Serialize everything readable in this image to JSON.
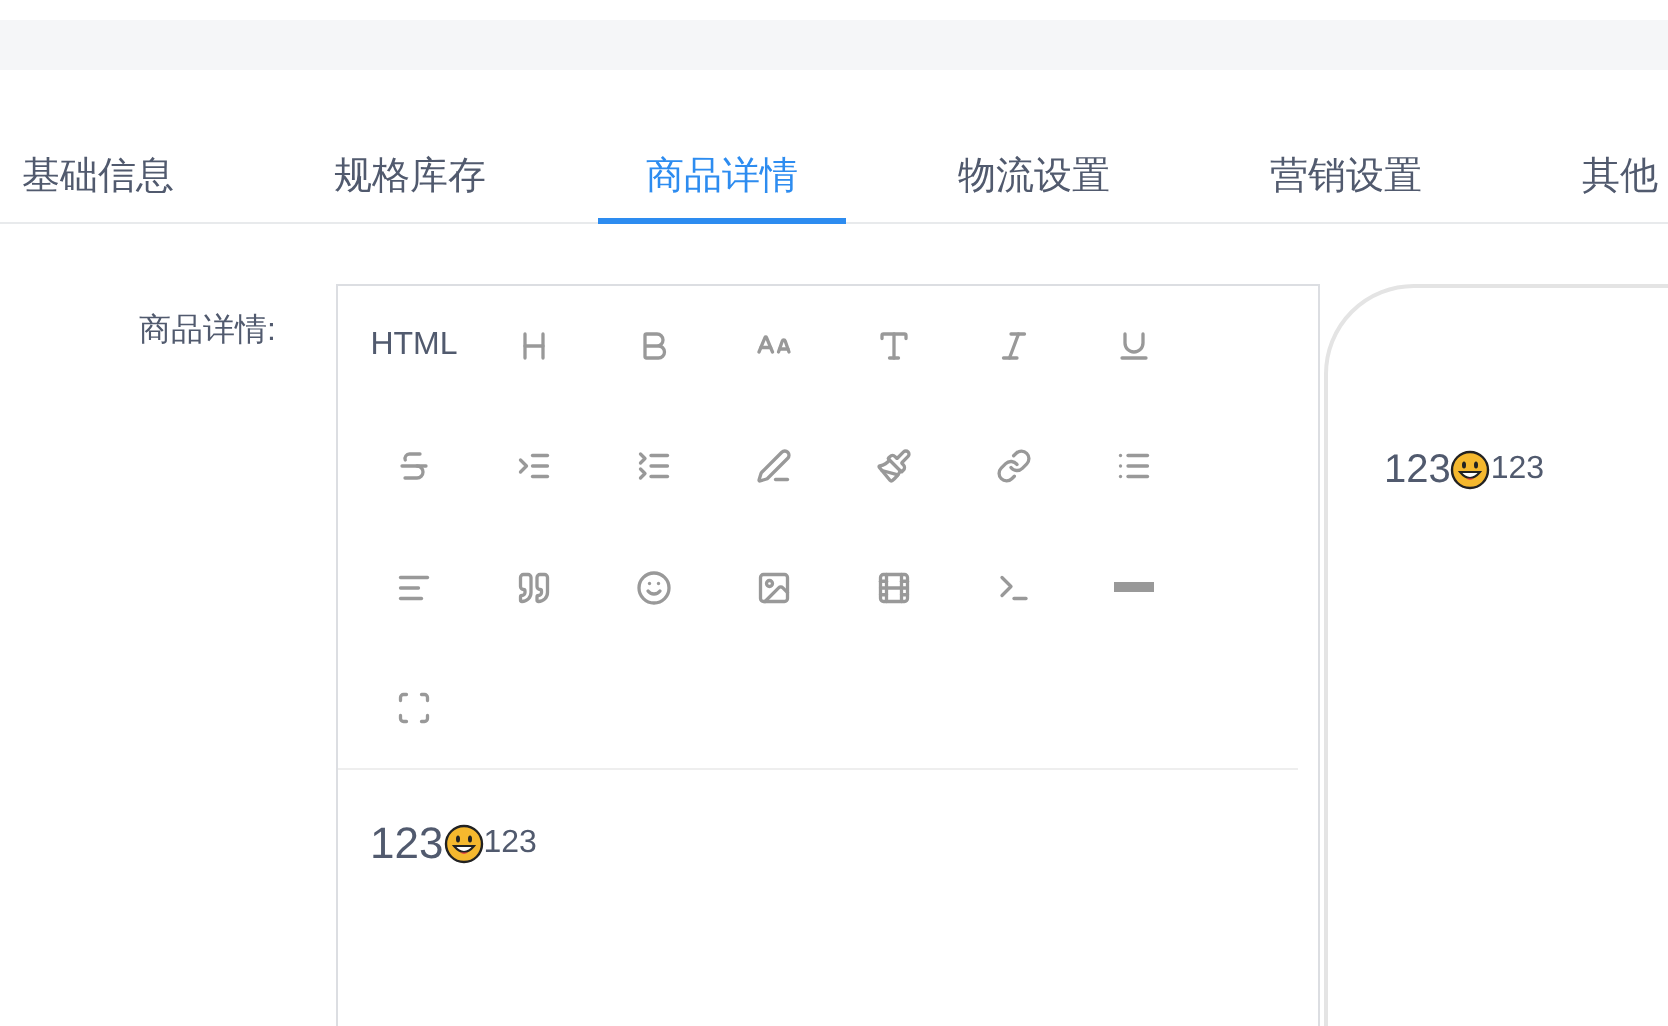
{
  "tabs": [
    {
      "label": "基础信息",
      "selected": false
    },
    {
      "label": "规格库存",
      "selected": false
    },
    {
      "label": "商品详情",
      "selected": true
    },
    {
      "label": "物流设置",
      "selected": false
    },
    {
      "label": "营销设置",
      "selected": false
    },
    {
      "label": "其他",
      "selected": false
    }
  ],
  "form": {
    "label": "商品详情:"
  },
  "editor": {
    "html_button": "HTML",
    "content": {
      "text_before": "123",
      "text_after": "123"
    }
  },
  "preview": {
    "content": {
      "text_before": "123",
      "text_after": "123"
    }
  }
}
